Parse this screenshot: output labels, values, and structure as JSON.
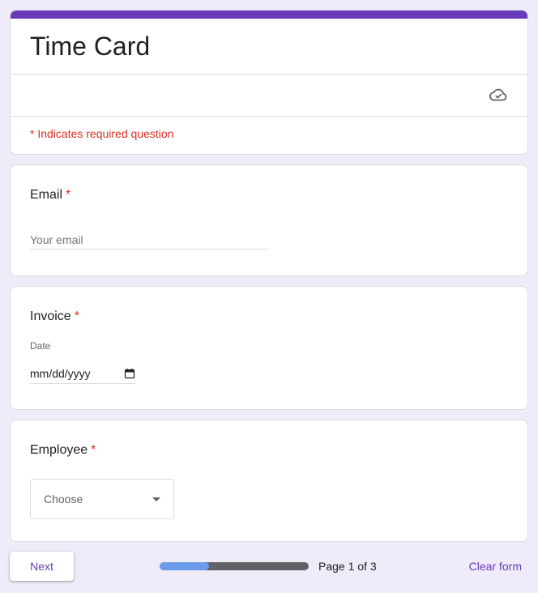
{
  "header": {
    "title": "Time Card",
    "required_note": "* Indicates required question",
    "save_status_icon": "cloud-check-icon"
  },
  "questions": {
    "email": {
      "label": "Email",
      "required_mark": "*",
      "placeholder": "Your email"
    },
    "invoice": {
      "label": "Invoice",
      "required_mark": "*",
      "sub_label": "Date",
      "date_placeholder": "mm/dd/yyyy"
    },
    "employee": {
      "label": "Employee",
      "required_mark": "*",
      "dropdown_value": "Choose"
    }
  },
  "footer": {
    "next_label": "Next",
    "page_text": "Page 1 of 3",
    "progress_fraction": 0.333,
    "clear_label": "Clear form"
  },
  "colors": {
    "accent": "#673ab7",
    "background": "#f0ebf8",
    "required": "#d93025",
    "progress_fill": "#6b9ceb",
    "progress_track": "#5f6368"
  }
}
